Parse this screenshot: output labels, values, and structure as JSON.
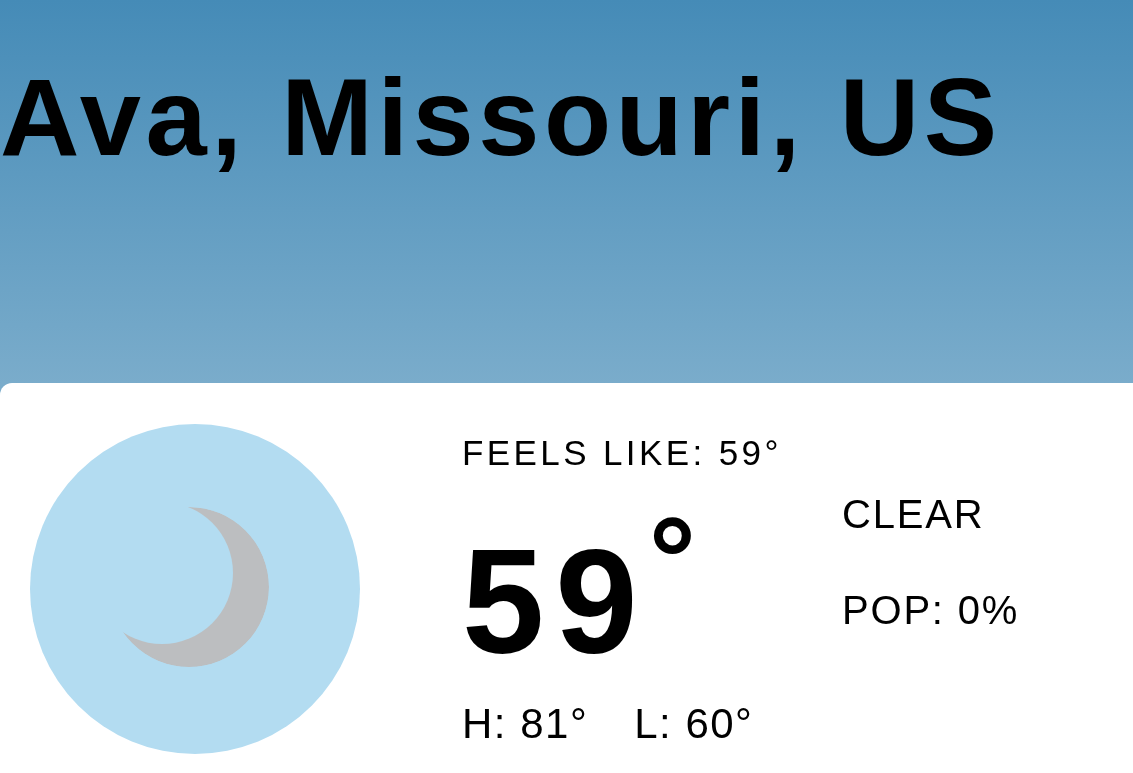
{
  "location": {
    "title": "Ava, Missouri, US"
  },
  "current": {
    "feels_like": "FEELS LIKE: 59°",
    "temperature": "59",
    "temperature_unit": "°",
    "high": "H: 81°",
    "low": "L: 60°",
    "condition": "CLEAR",
    "pop": "POP: 0%"
  }
}
